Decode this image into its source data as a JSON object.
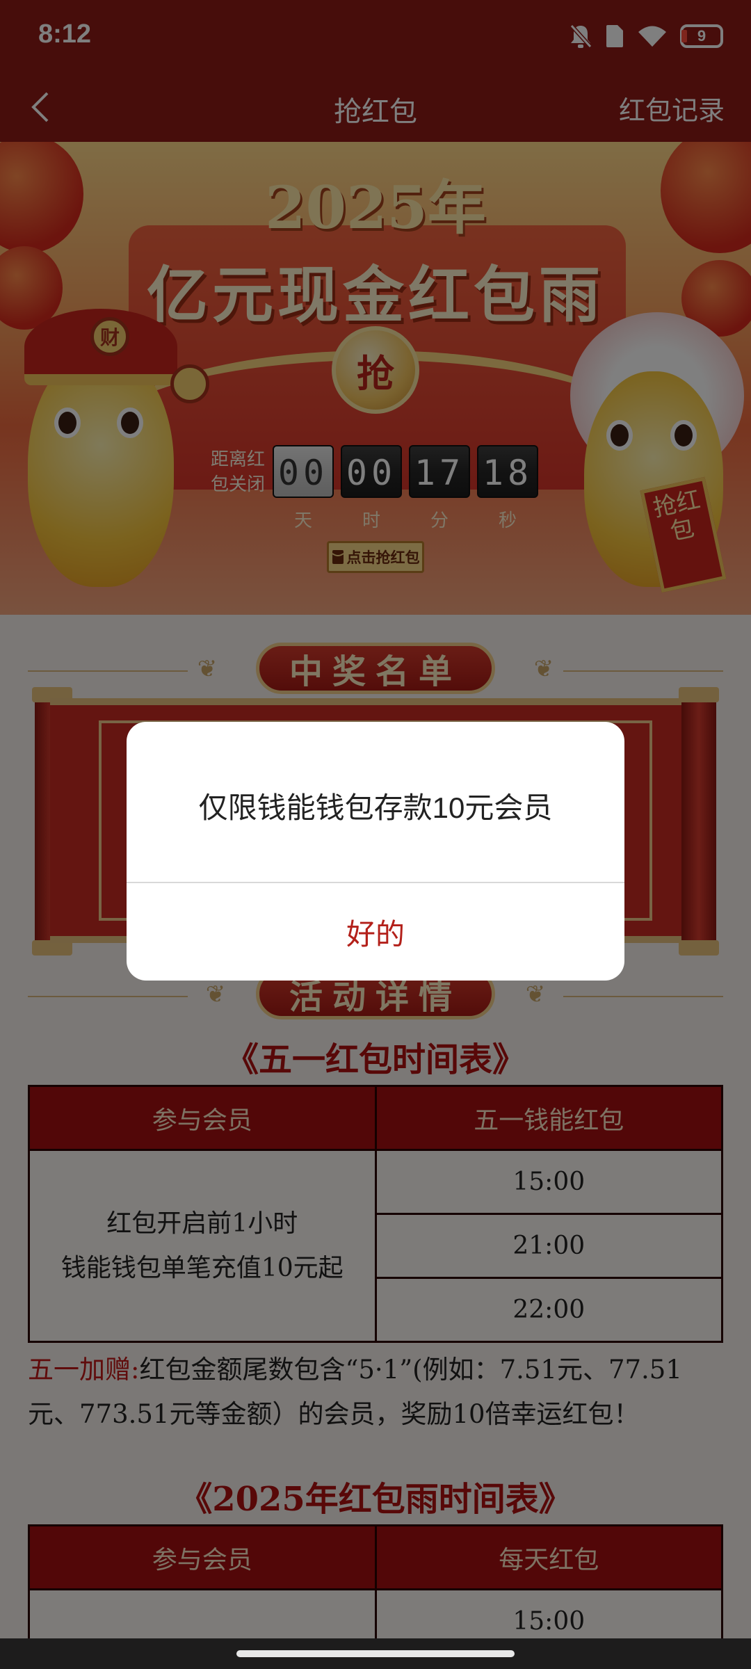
{
  "status_bar": {
    "time": "8:12",
    "battery": "9"
  },
  "nav": {
    "title": "抢红包",
    "right_link": "红包记录"
  },
  "banner": {
    "year": "2025年",
    "title": "亿元现金红包雨",
    "grab_char": "抢",
    "hat_char": "财",
    "scroll_text": "抢红包",
    "countdown_label": "距离红包关闭",
    "countdown": [
      {
        "value": "00",
        "unit": "天"
      },
      {
        "value": "00",
        "unit": "时"
      },
      {
        "value": "17",
        "unit": "分"
      },
      {
        "value": "18",
        "unit": "秒"
      }
    ],
    "grab_button": "点击抢红包"
  },
  "sections": {
    "winners_title": "中奖名单",
    "details_title": "活动详情"
  },
  "may_day_schedule": {
    "title": "《五一红包时间表》",
    "headers": [
      "参与会员",
      "五一钱能红包"
    ],
    "member_line1": "红包开启前1小时",
    "member_line2": "钱能钱包单笔充值10元起",
    "times": [
      "15:00",
      "21:00",
      "22:00"
    ]
  },
  "bonus": {
    "lead": "五一加赠:",
    "body": "红包金额尾数包含“5·1”(例如：7.51元、77.51元、773.51元等金额）的会员，奖励10倍幸运红包！"
  },
  "rain_schedule": {
    "title": "《2025年红包雨时间表》",
    "headers": [
      "参与会员",
      "每天红包"
    ],
    "times": [
      "15:00"
    ]
  },
  "dialog": {
    "message": "仅限钱能钱包存款10元会员",
    "ok_label": "好的"
  },
  "colors": {
    "primary_red": "#a40f10",
    "dialog_button": "#b3201a"
  }
}
